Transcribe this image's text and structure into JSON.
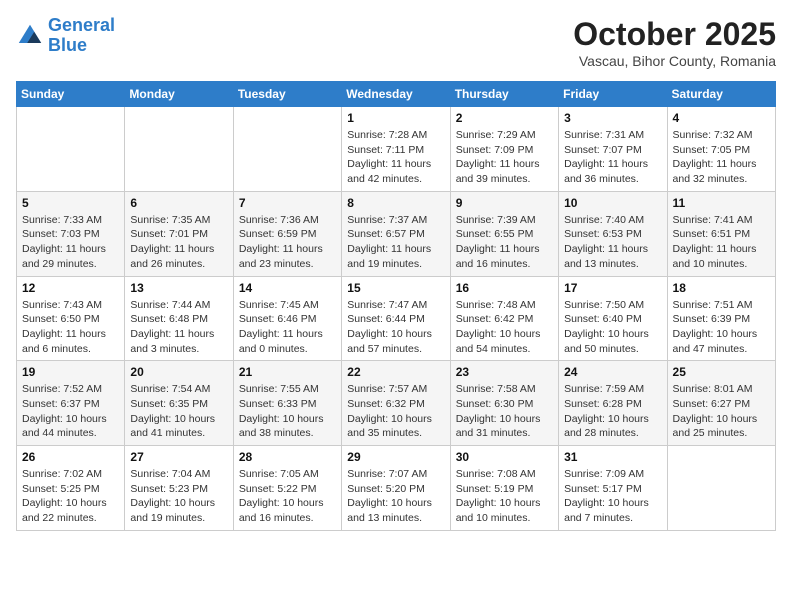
{
  "header": {
    "logo_line1": "General",
    "logo_line2": "Blue",
    "month": "October 2025",
    "location": "Vascau, Bihor County, Romania"
  },
  "weekdays": [
    "Sunday",
    "Monday",
    "Tuesday",
    "Wednesday",
    "Thursday",
    "Friday",
    "Saturday"
  ],
  "weeks": [
    [
      {
        "day": "",
        "info": ""
      },
      {
        "day": "",
        "info": ""
      },
      {
        "day": "",
        "info": ""
      },
      {
        "day": "1",
        "info": "Sunrise: 7:28 AM\nSunset: 7:11 PM\nDaylight: 11 hours\nand 42 minutes."
      },
      {
        "day": "2",
        "info": "Sunrise: 7:29 AM\nSunset: 7:09 PM\nDaylight: 11 hours\nand 39 minutes."
      },
      {
        "day": "3",
        "info": "Sunrise: 7:31 AM\nSunset: 7:07 PM\nDaylight: 11 hours\nand 36 minutes."
      },
      {
        "day": "4",
        "info": "Sunrise: 7:32 AM\nSunset: 7:05 PM\nDaylight: 11 hours\nand 32 minutes."
      }
    ],
    [
      {
        "day": "5",
        "info": "Sunrise: 7:33 AM\nSunset: 7:03 PM\nDaylight: 11 hours\nand 29 minutes."
      },
      {
        "day": "6",
        "info": "Sunrise: 7:35 AM\nSunset: 7:01 PM\nDaylight: 11 hours\nand 26 minutes."
      },
      {
        "day": "7",
        "info": "Sunrise: 7:36 AM\nSunset: 6:59 PM\nDaylight: 11 hours\nand 23 minutes."
      },
      {
        "day": "8",
        "info": "Sunrise: 7:37 AM\nSunset: 6:57 PM\nDaylight: 11 hours\nand 19 minutes."
      },
      {
        "day": "9",
        "info": "Sunrise: 7:39 AM\nSunset: 6:55 PM\nDaylight: 11 hours\nand 16 minutes."
      },
      {
        "day": "10",
        "info": "Sunrise: 7:40 AM\nSunset: 6:53 PM\nDaylight: 11 hours\nand 13 minutes."
      },
      {
        "day": "11",
        "info": "Sunrise: 7:41 AM\nSunset: 6:51 PM\nDaylight: 11 hours\nand 10 minutes."
      }
    ],
    [
      {
        "day": "12",
        "info": "Sunrise: 7:43 AM\nSunset: 6:50 PM\nDaylight: 11 hours\nand 6 minutes."
      },
      {
        "day": "13",
        "info": "Sunrise: 7:44 AM\nSunset: 6:48 PM\nDaylight: 11 hours\nand 3 minutes."
      },
      {
        "day": "14",
        "info": "Sunrise: 7:45 AM\nSunset: 6:46 PM\nDaylight: 11 hours\nand 0 minutes."
      },
      {
        "day": "15",
        "info": "Sunrise: 7:47 AM\nSunset: 6:44 PM\nDaylight: 10 hours\nand 57 minutes."
      },
      {
        "day": "16",
        "info": "Sunrise: 7:48 AM\nSunset: 6:42 PM\nDaylight: 10 hours\nand 54 minutes."
      },
      {
        "day": "17",
        "info": "Sunrise: 7:50 AM\nSunset: 6:40 PM\nDaylight: 10 hours\nand 50 minutes."
      },
      {
        "day": "18",
        "info": "Sunrise: 7:51 AM\nSunset: 6:39 PM\nDaylight: 10 hours\nand 47 minutes."
      }
    ],
    [
      {
        "day": "19",
        "info": "Sunrise: 7:52 AM\nSunset: 6:37 PM\nDaylight: 10 hours\nand 44 minutes."
      },
      {
        "day": "20",
        "info": "Sunrise: 7:54 AM\nSunset: 6:35 PM\nDaylight: 10 hours\nand 41 minutes."
      },
      {
        "day": "21",
        "info": "Sunrise: 7:55 AM\nSunset: 6:33 PM\nDaylight: 10 hours\nand 38 minutes."
      },
      {
        "day": "22",
        "info": "Sunrise: 7:57 AM\nSunset: 6:32 PM\nDaylight: 10 hours\nand 35 minutes."
      },
      {
        "day": "23",
        "info": "Sunrise: 7:58 AM\nSunset: 6:30 PM\nDaylight: 10 hours\nand 31 minutes."
      },
      {
        "day": "24",
        "info": "Sunrise: 7:59 AM\nSunset: 6:28 PM\nDaylight: 10 hours\nand 28 minutes."
      },
      {
        "day": "25",
        "info": "Sunrise: 8:01 AM\nSunset: 6:27 PM\nDaylight: 10 hours\nand 25 minutes."
      }
    ],
    [
      {
        "day": "26",
        "info": "Sunrise: 7:02 AM\nSunset: 5:25 PM\nDaylight: 10 hours\nand 22 minutes."
      },
      {
        "day": "27",
        "info": "Sunrise: 7:04 AM\nSunset: 5:23 PM\nDaylight: 10 hours\nand 19 minutes."
      },
      {
        "day": "28",
        "info": "Sunrise: 7:05 AM\nSunset: 5:22 PM\nDaylight: 10 hours\nand 16 minutes."
      },
      {
        "day": "29",
        "info": "Sunrise: 7:07 AM\nSunset: 5:20 PM\nDaylight: 10 hours\nand 13 minutes."
      },
      {
        "day": "30",
        "info": "Sunrise: 7:08 AM\nSunset: 5:19 PM\nDaylight: 10 hours\nand 10 minutes."
      },
      {
        "day": "31",
        "info": "Sunrise: 7:09 AM\nSunset: 5:17 PM\nDaylight: 10 hours\nand 7 minutes."
      },
      {
        "day": "",
        "info": ""
      }
    ]
  ]
}
